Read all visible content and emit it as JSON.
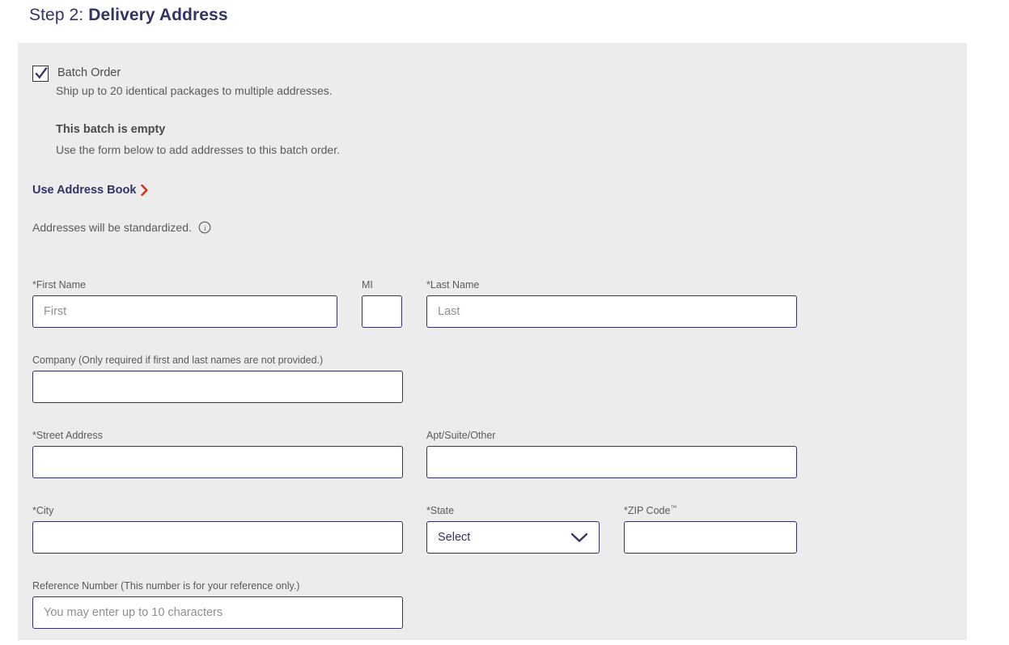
{
  "heading": {
    "step_label": "Step 2:",
    "step_title": "Delivery Address"
  },
  "batch": {
    "checkbox_label": "Batch Order",
    "checkbox_checked": true,
    "description": "Ship up to 20 identical packages to multiple addresses.",
    "empty_title": "This batch is empty",
    "empty_description": "Use the form below to add addresses to this batch order."
  },
  "address_book": {
    "label": "Use Address Book",
    "chevron_icon": "chevron-right-icon",
    "chevron_color": "#d42e12"
  },
  "standardized_note": {
    "text": "Addresses will be standardized.",
    "info_icon": "info-circle-icon"
  },
  "form": {
    "first_name": {
      "label": "*First Name",
      "placeholder": "First",
      "value": ""
    },
    "middle_initial": {
      "label": "MI",
      "placeholder": "",
      "value": ""
    },
    "last_name": {
      "label": "*Last Name",
      "placeholder": "Last",
      "value": ""
    },
    "company": {
      "label": "Company (Only required if first and last names are not provided.)",
      "placeholder": "",
      "value": ""
    },
    "street_address": {
      "label": "*Street Address",
      "placeholder": "",
      "value": ""
    },
    "apt_suite": {
      "label": "Apt/Suite/Other",
      "placeholder": "",
      "value": ""
    },
    "city": {
      "label": "*City",
      "placeholder": "",
      "value": ""
    },
    "state": {
      "label": "*State",
      "selected": "Select",
      "chevron_icon": "chevron-down-icon"
    },
    "zip_code": {
      "label_main": "*ZIP Code",
      "label_sup": "™",
      "placeholder": "",
      "value": ""
    },
    "reference_number": {
      "label": "Reference Number (This number is for your reference only.)",
      "placeholder": "You may enter up to 10 characters",
      "value": ""
    }
  },
  "colors": {
    "navy": "#333366",
    "red": "#d42e12",
    "panel_bg": "#ececec",
    "label_gray": "#5a5a5a"
  }
}
